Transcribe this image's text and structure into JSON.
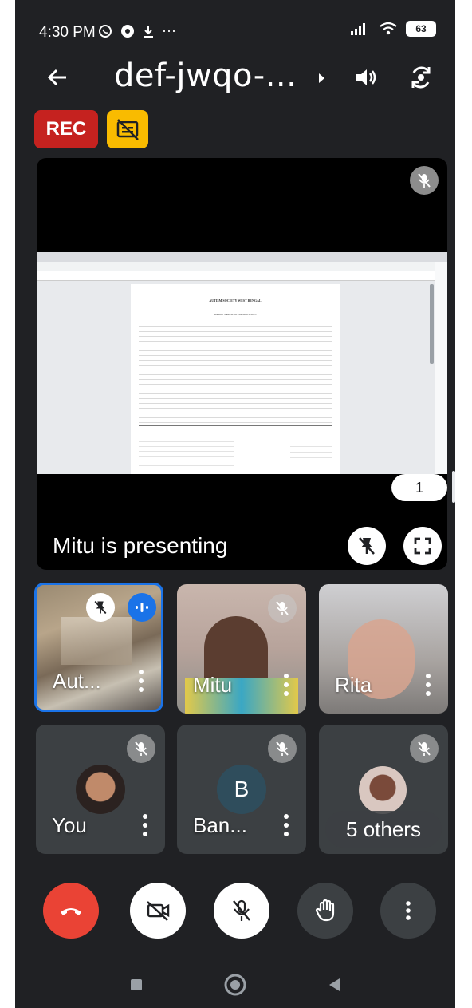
{
  "status_bar": {
    "time": "4:30 PM",
    "battery": "63",
    "more": "···"
  },
  "header": {
    "meeting_code": "def-jwqo-...",
    "icons": [
      "back-arrow-icon",
      "chevron-right-icon",
      "speaker-icon",
      "switch-camera-icon"
    ]
  },
  "badges": {
    "rec_label": "REC",
    "cc_icon": "captions-off-icon"
  },
  "presentation": {
    "label": "Mitu is presenting",
    "page_number": "1",
    "doc_heading": "AUTISM SOCIETY WEST BENGAL",
    "doc_subheading": "Balance Sheet as on 31st March 2023"
  },
  "participants": [
    {
      "name": "Aut...",
      "speaking": true
    },
    {
      "name": "Mitu",
      "muted": true
    },
    {
      "name": "Rita",
      "muted": false
    },
    {
      "name": "You",
      "muted": true
    },
    {
      "name": "Ban...",
      "initial": "B",
      "muted": true
    },
    {
      "name": "5 others",
      "muted": true
    }
  ],
  "controls": [
    "end-call-icon",
    "camera-off-icon",
    "mic-off-icon",
    "raise-hand-icon",
    "more-icon"
  ],
  "colors": {
    "background": "#202124",
    "end_call": "#ea4335",
    "rec": "#c5221f",
    "cc": "#f9bb00",
    "active_speaker": "#1a73e8"
  }
}
